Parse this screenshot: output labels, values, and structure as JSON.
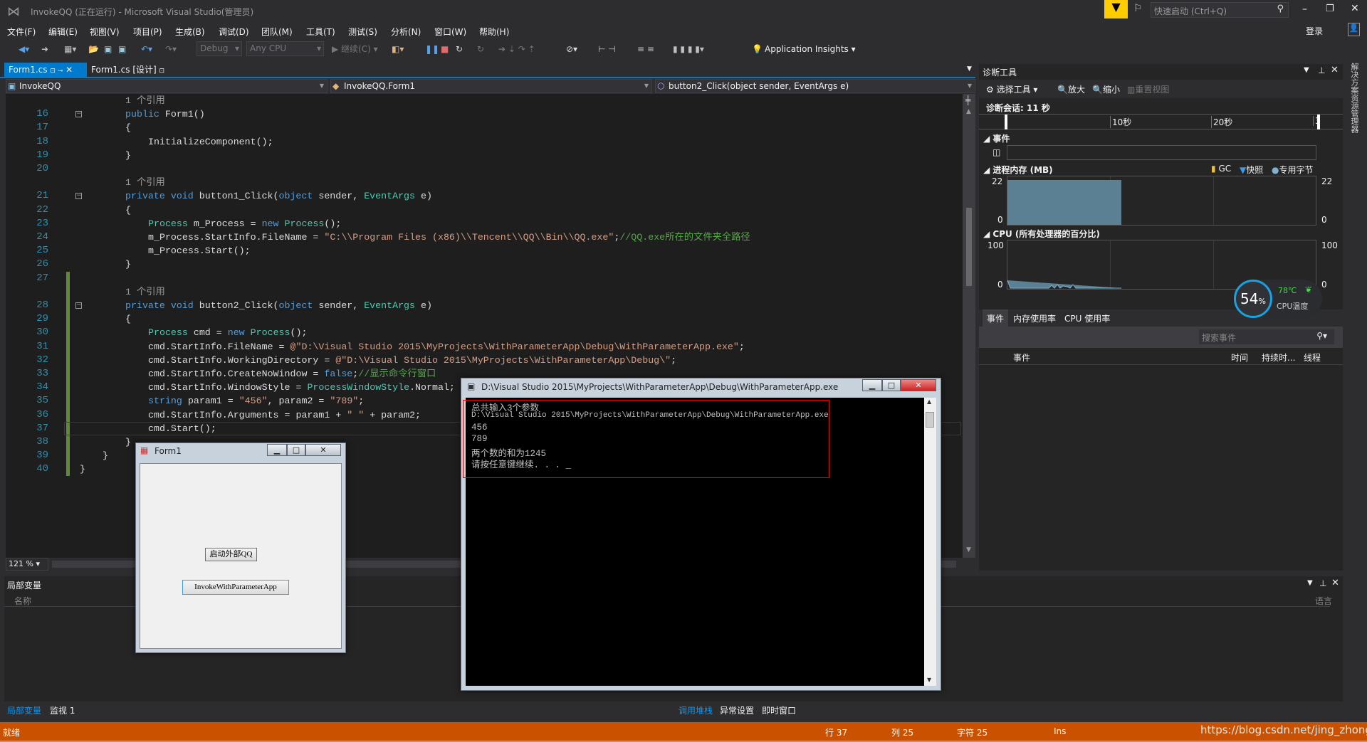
{
  "window": {
    "title": "InvokeQQ (正在运行) - Microsoft Visual Studio(管理员)",
    "quick_launch_placeholder": "快速启动 (Ctrl+Q)",
    "signin": "登录"
  },
  "menu": [
    "文件(F)",
    "编辑(E)",
    "视图(V)",
    "项目(P)",
    "生成(B)",
    "调试(D)",
    "团队(M)",
    "工具(T)",
    "测试(S)",
    "分析(N)",
    "窗口(W)",
    "帮助(H)"
  ],
  "toolbar": {
    "config": "Debug",
    "platform": "Any CPU",
    "continue": "继续(C)",
    "app_insights": "Application Insights"
  },
  "tabs": [
    {
      "label": "Form1.cs",
      "active": true
    },
    {
      "label": "Form1.cs [设计]",
      "active": false
    }
  ],
  "nav": {
    "project": "InvokeQQ",
    "class": "InvokeQQ.Form1",
    "member": "button2_Click(object sender, EventArgs e)"
  },
  "editor": {
    "zoom": "121 %",
    "current_line": "37",
    "lines": [
      {
        "ref": "1 个引用",
        "level": 2
      },
      {
        "num": "16",
        "level": 2,
        "fold": true,
        "tokens": [
          [
            "kw",
            "public"
          ],
          [
            "tx",
            " Form1()"
          ]
        ]
      },
      {
        "num": "17",
        "level": 2,
        "tokens": [
          [
            "tx",
            "{"
          ]
        ]
      },
      {
        "num": "18",
        "level": 3,
        "tokens": [
          [
            "tx",
            "InitializeComponent();"
          ]
        ]
      },
      {
        "num": "19",
        "level": 2,
        "tokens": [
          [
            "tx",
            "}"
          ]
        ]
      },
      {
        "num": "20",
        "level": 2,
        "tokens": []
      },
      {
        "ref": "1 个引用",
        "level": 2
      },
      {
        "num": "21",
        "level": 2,
        "fold": true,
        "tokens": [
          [
            "kw",
            "private void"
          ],
          [
            "tx",
            " button1_Click("
          ],
          [
            "kw",
            "object"
          ],
          [
            "tx",
            " sender, "
          ],
          [
            "ty",
            "EventArgs"
          ],
          [
            "tx",
            " e)"
          ]
        ]
      },
      {
        "num": "22",
        "level": 2,
        "tokens": [
          [
            "tx",
            "{"
          ]
        ]
      },
      {
        "num": "23",
        "level": 3,
        "tokens": [
          [
            "ty",
            "Process"
          ],
          [
            "tx",
            " m_Process = "
          ],
          [
            "kw",
            "new"
          ],
          [
            "tx",
            " "
          ],
          [
            "ty",
            "Process"
          ],
          [
            "tx",
            "();"
          ]
        ]
      },
      {
        "num": "24",
        "level": 3,
        "tokens": [
          [
            "tx",
            "m_Process.StartInfo.FileName = "
          ],
          [
            "st",
            "\"C:\\\\Program Files (x86)\\\\Tencent\\\\QQ\\\\Bin\\\\QQ.exe\""
          ],
          [
            "tx",
            ";"
          ],
          [
            "cm",
            "//QQ.exe所在的文件夹全路径"
          ]
        ]
      },
      {
        "num": "25",
        "level": 3,
        "tokens": [
          [
            "tx",
            "m_Process.Start();"
          ]
        ]
      },
      {
        "num": "26",
        "level": 2,
        "tokens": [
          [
            "tx",
            "}"
          ]
        ]
      },
      {
        "num": "27",
        "level": 2,
        "tokens": []
      },
      {
        "ref": "1 个引用",
        "level": 2
      },
      {
        "num": "28",
        "level": 2,
        "fold": true,
        "tokens": [
          [
            "kw",
            "private void"
          ],
          [
            "tx",
            " button2_Click("
          ],
          [
            "kw",
            "object"
          ],
          [
            "tx",
            " sender, "
          ],
          [
            "ty",
            "EventArgs"
          ],
          [
            "tx",
            " e)"
          ]
        ]
      },
      {
        "num": "29",
        "level": 2,
        "tokens": [
          [
            "tx",
            "{"
          ]
        ]
      },
      {
        "num": "30",
        "level": 3,
        "tokens": [
          [
            "ty",
            "Process"
          ],
          [
            "tx",
            " cmd = "
          ],
          [
            "kw",
            "new"
          ],
          [
            "tx",
            " "
          ],
          [
            "ty",
            "Process"
          ],
          [
            "tx",
            "();"
          ]
        ]
      },
      {
        "num": "31",
        "level": 3,
        "tokens": [
          [
            "tx",
            "cmd.StartInfo.FileName = "
          ],
          [
            "st",
            "@\"D:\\Visual Studio 2015\\MyProjects\\WithParameterApp\\Debug\\WithParameterApp.exe\""
          ],
          [
            "tx",
            ";"
          ]
        ]
      },
      {
        "num": "32",
        "level": 3,
        "tokens": [
          [
            "tx",
            "cmd.StartInfo.WorkingDirectory = "
          ],
          [
            "st",
            "@\"D:\\Visual Studio 2015\\MyProjects\\WithParameterApp\\Debug\\\""
          ],
          [
            "tx",
            ";"
          ]
        ]
      },
      {
        "num": "33",
        "level": 3,
        "tokens": [
          [
            "tx",
            "cmd.StartInfo.CreateNoWindow = "
          ],
          [
            "kw",
            "false"
          ],
          [
            "tx",
            ";"
          ],
          [
            "cm",
            "//显示命令行窗口"
          ]
        ]
      },
      {
        "num": "34",
        "level": 3,
        "tokens": [
          [
            "tx",
            "cmd.StartInfo.WindowStyle = "
          ],
          [
            "ty",
            "ProcessWindowStyle"
          ],
          [
            "tx",
            ".Normal;"
          ]
        ]
      },
      {
        "num": "35",
        "level": 3,
        "tokens": [
          [
            "kw",
            "string"
          ],
          [
            "tx",
            " param1 = "
          ],
          [
            "st",
            "\"456\""
          ],
          [
            "tx",
            ", param2 = "
          ],
          [
            "st",
            "\"789\""
          ],
          [
            "tx",
            ";"
          ]
        ]
      },
      {
        "num": "36",
        "level": 3,
        "tokens": [
          [
            "tx",
            "cmd.StartInfo.Arguments = param1 + "
          ],
          [
            "st",
            "\" \""
          ],
          [
            "tx",
            " + param2;"
          ]
        ]
      },
      {
        "num": "37",
        "level": 3,
        "tokens": [
          [
            "tx",
            "cmd.Start();"
          ]
        ]
      },
      {
        "num": "38",
        "level": 2,
        "tokens": [
          [
            "tx",
            "}"
          ]
        ]
      },
      {
        "num": "39",
        "level": 1,
        "tokens": [
          [
            "tx",
            "}"
          ]
        ]
      },
      {
        "num": "40",
        "level": 0,
        "tokens": [
          [
            "tx",
            "}"
          ]
        ]
      }
    ]
  },
  "diag": {
    "title": "诊断工具",
    "select_tools": "选择工具",
    "zoom_in": "放大",
    "zoom_out": "缩小",
    "reset_view": "重置视图",
    "session": "诊断会话: 11 秒",
    "timeline_ticks": [
      "10秒",
      "20秒",
      "3"
    ],
    "events_section": "事件",
    "memory_section": "进程内存 (MB)",
    "legend": [
      "GC",
      "快照",
      "专用字节"
    ],
    "memory_max": "22",
    "memory_min": "0",
    "cpu_section": "CPU (所有处理器的百分比)",
    "cpu_max": "100",
    "cpu_min": "0",
    "memory_fill_fraction": 0.92,
    "tabs": [
      "事件",
      "内存使用率",
      "CPU 使用率"
    ],
    "search_placeholder": "搜索事件",
    "columns": [
      "事件",
      "时间",
      "持续时...",
      "线程"
    ],
    "colors": {
      "memory": "#5b7f93",
      "gauge": "#1ba1e2"
    }
  },
  "gauge": {
    "percent": "54",
    "unit": "%",
    "temp": "78℃",
    "label": "CPU温度"
  },
  "side_strip": "解决方案资源管理器",
  "bottom": {
    "title": "局部变量",
    "name_col": "名称",
    "lang_col": "语言",
    "left_tabs": [
      "局部变量",
      "监视 1"
    ],
    "right_tabs": [
      "调用堆栈",
      "异常设置",
      "即时窗口"
    ]
  },
  "status": {
    "ready": "就绪",
    "line": "行 37",
    "col": "列 25",
    "char": "字符 25",
    "mode": "Ins",
    "watermark": "https://blog.csdn.net/jing_zhong"
  },
  "form1": {
    "title": "Form1",
    "button1": "启动外部QQ",
    "button2": "InvokeWithParameterApp"
  },
  "console": {
    "title": "D:\\Visual Studio 2015\\MyProjects\\WithParameterApp\\Debug\\WithParameterApp.exe",
    "lines": [
      "总共输入3个参数",
      "D:\\Visual Studio 2015\\MyProjects\\WithParameterApp\\Debug\\WithParameterApp.exe",
      "456",
      "789",
      "两个数的和为1245",
      "请按任意键继续. . . _"
    ]
  }
}
